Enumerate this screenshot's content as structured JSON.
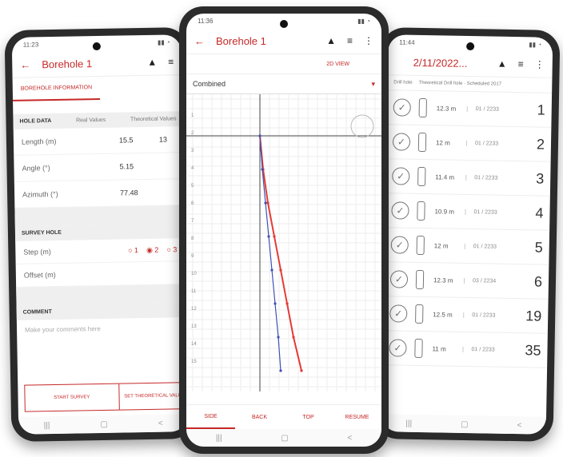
{
  "left_phone": {
    "status_time": "11:23",
    "title": "Borehole 1",
    "tab": "BOREHOLE INFORMATION",
    "hole_data": {
      "header": "HOLE DATA",
      "col1": "Real Values",
      "col2": "Theoretical Values",
      "rows": [
        {
          "label": "Length (m)",
          "value": "15.5",
          "value2": "13"
        },
        {
          "label": "Angle (°)",
          "value": "5.15",
          "value2": ""
        },
        {
          "label": "Azimuth (°)",
          "value": "77.48",
          "value2": ""
        }
      ]
    },
    "survey": {
      "header": "SURVEY HOLE",
      "step_label": "Step (m)",
      "options": [
        "1",
        "2",
        "3"
      ],
      "offset_label": "Offset (m)"
    },
    "comment": {
      "header": "COMMENT",
      "placeholder": "Make your comments here"
    },
    "buttons": {
      "start": "START SURVEY",
      "theoretical": "SET THEORETICAL VALUES ON PAPER"
    }
  },
  "center_phone": {
    "status_time": "11:36",
    "title": "Borehole 1",
    "view_button": "2D VIEW",
    "dropdown": "Combined",
    "tabs": [
      "SIDE",
      "BACK",
      "TOP",
      "RESUME"
    ],
    "active_tab": 0
  },
  "right_phone": {
    "status_time": "11:44",
    "title": "2/11/2022...",
    "filter1": "Drill hole",
    "filter2": "Theoretical Drill hole · Scheduled 2017",
    "items": [
      {
        "length": "12.3 m",
        "date": "01 / 2233",
        "number": "1"
      },
      {
        "length": "12 m",
        "date": "01 / 2233",
        "number": "2"
      },
      {
        "length": "11.4 m",
        "date": "01 / 2233",
        "number": "3"
      },
      {
        "length": "10.9 m",
        "date": "01 / 2233",
        "number": "4"
      },
      {
        "length": "12 m",
        "date": "01 / 2233",
        "number": "5"
      },
      {
        "length": "12.3 m",
        "date": "03 / 2234",
        "number": "6"
      },
      {
        "length": "12.5 m",
        "date": "01 / 2233",
        "number": "19"
      },
      {
        "length": "11 m",
        "date": "01 / 2233",
        "number": "35"
      }
    ]
  },
  "chart_data": {
    "type": "line",
    "title": "",
    "xlabel": "",
    "ylabel": "",
    "y_ticks": [
      "1",
      "2",
      "3",
      "4",
      "5",
      "6",
      "7",
      "8",
      "9",
      "10",
      "11",
      "12",
      "13",
      "14",
      "15"
    ],
    "series": [
      {
        "color": "#e53935",
        "x": [
          0,
          0.2,
          0.5,
          0.9,
          1.3,
          1.7,
          2.1,
          2.6
        ],
        "y": [
          0,
          2,
          4,
          6,
          8,
          10,
          12,
          14
        ]
      },
      {
        "color": "#3f51b5",
        "x": [
          0,
          0.15,
          0.35,
          0.55,
          0.75,
          0.95,
          1.15,
          1.3
        ],
        "y": [
          0,
          2,
          4,
          6,
          8,
          10,
          12,
          14
        ]
      }
    ]
  }
}
